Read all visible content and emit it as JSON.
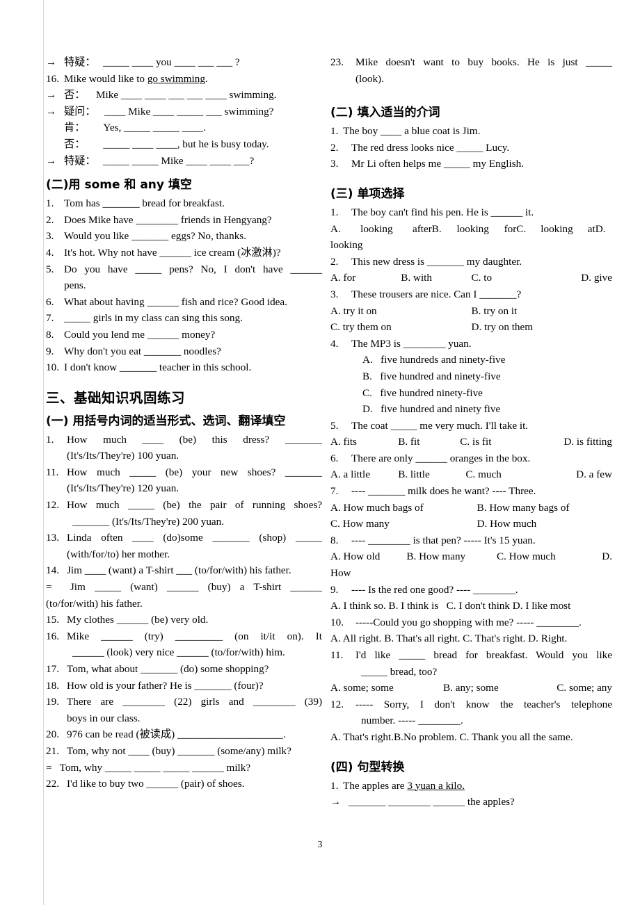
{
  "page": {
    "number": "3"
  },
  "left_column": {
    "top_block": {
      "lines": [
        {
          "arrow": "→",
          "label": "特疑：",
          "text": "_____ ____ you ____ ___ ___ ?"
        },
        {
          "num": "16.",
          "text": "Mike would like to go swimming.",
          "underline": "go swimming"
        },
        {
          "arrow": "→",
          "label": "否：",
          "text": "Mike ____ ____ ___ ___ ____ swimming."
        },
        {
          "arrow": "→",
          "label": "疑问：",
          "text": "____ Mike ____ _____ ___ swimming?"
        },
        {
          "label": "肯：",
          "text": "Yes, _____ _____ ____."
        },
        {
          "label": "否：",
          "text": "_____ ____ ____, but he is busy today."
        },
        {
          "arrow": "→",
          "label": "特疑：",
          "text": "_____ _____ Mike ____ ____ ___?"
        }
      ]
    },
    "section_some_any": {
      "heading": "(二)用 some 和 any  填空",
      "items": [
        {
          "num": "1.",
          "text": "Tom has _______ bread for breakfast."
        },
        {
          "num": "2.",
          "text": "Does Mike have ________ friends in Hengyang?"
        },
        {
          "num": "3.",
          "text": "Would you like _______ eggs? No, thanks."
        },
        {
          "num": "4.",
          "text": "It's hot. Why not have ______ ice cream (冰激淋)?"
        },
        {
          "num": "5.",
          "text": "Do you have _____ pens? No, I don't have ______ pens.",
          "line1": "Do  you  have  _____  pens?  No,  I  don't  have  ______",
          "line2": "pens."
        },
        {
          "num": "6.",
          "text": "What about having ______ fish and rice? Good idea."
        },
        {
          "num": "7.",
          "text": "_____ girls in my class can sing this song."
        },
        {
          "num": "8.",
          "text": "Could you lend me ______ money?"
        },
        {
          "num": "9.",
          "text": "Why don't you eat _______ noodles?"
        },
        {
          "num": "10.",
          "text": "I don't know _______ teacher in this school."
        }
      ]
    },
    "section_three": {
      "heading": "三、基础知识巩固练习",
      "subheading": "(一) 用括号内词的适当形式、选词、翻译填空",
      "items": [
        {
          "num": "1.",
          "line1": "How   much   ____   (be)   this   dress?   _______",
          "line2": "(It's/Its/They're) 100 yuan."
        },
        {
          "num": "11.",
          "line1": "How  much  _____  (be)  your  new  shoes?  _______",
          "line2": "(It's/Its/They're) 120 yuan."
        },
        {
          "num": "12.",
          "line1": "How  much  _____  (be)  the  pair  of  running  shoes?",
          "line2": "_______ (It's/Its/They're) 200 yuan."
        },
        {
          "num": "13.",
          "line1": "Linda  often  ____  (do)some  _______  (shop)  _____",
          "line2": "(with/for/to) her mother."
        },
        {
          "num": "14.",
          "line1": "Jim ____ (want) a T-shirt ___ (to/for/with) his father.",
          "line2": "=    Jim  _____  (want)  ______  (buy)  a  T-shirt  ______",
          "line3": "(to/for/with) his father."
        },
        {
          "num": "15.",
          "line1": "My clothes ______ (be) very old."
        },
        {
          "num": "16.",
          "line1": "Mike  ______  (try)  _________  (on  it/it  on).  It",
          "line2": "______ (look) very nice ______ (to/for/with) him."
        },
        {
          "num": "17.",
          "line1": "Tom, what about _______ (do) some shopping?"
        },
        {
          "num": "18.",
          "line1": "How old is your father? He is _______ (four)?"
        },
        {
          "num": "19.",
          "line1": "There  are  ________  (22)  girls  and  ________  (39)",
          "line2": "boys in our class."
        },
        {
          "num": "20.",
          "line1": "976 can be read (被读成) ____________________."
        },
        {
          "num": "21.",
          "line1": "Tom, why not ____ (buy) _______ (some/any) milk?",
          "line2": "=   Tom, why _____ _____ _____ ______ milk?"
        },
        {
          "num": "22.",
          "line1": "I'd like to buy two ______ (pair) of shoes."
        }
      ]
    }
  },
  "right_column": {
    "item23": {
      "num": "23.",
      "line1": "Mike  doesn't  want  to  buy  books.  He  is  just  _____",
      "line2": "(look)."
    },
    "section_prepositions": {
      "heading": "(二) 填入适当的介词",
      "items": [
        {
          "num": "1.",
          "text": "The boy ____ a blue coat is Jim."
        },
        {
          "num": "2.",
          "text": "The red dress looks nice _____ Lucy."
        },
        {
          "num": "3.",
          "text": "Mr Li often helps me _____ my English."
        }
      ]
    },
    "section_multiple_choice": {
      "heading": "(三) 单项选择",
      "questions": [
        {
          "num": "1.",
          "stem": "The boy can't find his pen. He is ______ it.",
          "options_line1": [
            "A. looking after",
            "B. looking for",
            "C. looking at",
            "D."
          ],
          "options_line2": [
            "looking"
          ],
          "layout": "wrap4"
        },
        {
          "num": "2.",
          "stem": "This new dress is _______ my daughter.",
          "options": [
            "A. for",
            "B. with",
            "C. to",
            "D. give"
          ],
          "layout": "row4"
        },
        {
          "num": "3.",
          "stem": "These trousers are nice. Can I _______?",
          "options_line1": [
            "A. try it on",
            "B. try on it"
          ],
          "options_line2": [
            "C. try them on",
            "D. try on them"
          ],
          "layout": "grid2x2"
        },
        {
          "num": "4.",
          "stem": "The MP3 is ________ yuan.",
          "options_stacked": [
            "A.   five hundreds and ninety-five",
            "B.   five hundred and ninety-five",
            "C.   five hundred ninety-five",
            "D.   five hundred and ninety five"
          ],
          "layout": "stacked"
        },
        {
          "num": "5.",
          "stem": "The coat _____ me very much. I'll take it.",
          "options": [
            "A. fits",
            "B. fit",
            "C. is fit",
            "D. is fitting"
          ],
          "layout": "row4"
        },
        {
          "num": "6.",
          "stem": "There are only ______ oranges in the box.",
          "options": [
            "A. a little",
            "B. little",
            "C. much",
            "D. a few"
          ],
          "layout": "row4"
        },
        {
          "num": "7.",
          "stem": "---- _______ milk does he want? ---- Three.",
          "options_line1": [
            "A. How much bags of",
            "B. How many bags of"
          ],
          "options_line2": [
            "C. How many",
            "D. How much"
          ],
          "layout": "grid2x2"
        },
        {
          "num": "8.",
          "stem": "---- ________ is that pen? ----- It's 15 yuan.",
          "options_line1": [
            "A. How old",
            "B. How many",
            "C. How much",
            "D."
          ],
          "options_line2": [
            "How"
          ],
          "layout": "wrap4"
        },
        {
          "num": "9.",
          "stem": "---- Is the red one good? ---- ________.",
          "options_inline": "A. I think so. B. I think is   C. I don't think D. I like most",
          "layout": "inline"
        },
        {
          "num": "10.",
          "stem": "-----Could you go shopping with me? ----- ________.",
          "options_inline": "A. All right. B. That's all right. C. That's right. D. Right.",
          "layout": "inline"
        },
        {
          "num": "11.",
          "stem_line1": "I'd  like  _____  bread  for  breakfast.  Would  you  like",
          "stem_line2": "_____ bread, too?",
          "options": [
            "A. some; some",
            "B. any; some",
            "C. some; any"
          ],
          "layout": "row3"
        },
        {
          "num": "12.",
          "stem_line1": "-----  Sorry,  I  don't  know  the  teacher's  telephone",
          "stem_line2": "number. ----- ________.",
          "options_inline": "A. That's right.B.No problem. C. Thank you all the same.",
          "layout": "inline"
        }
      ]
    },
    "section_sentence_transform": {
      "heading": "(四) 句型转换",
      "items": [
        {
          "num": "1.",
          "text": "The apples are 3 yuan a kilo.",
          "underline": "3 yuan a kilo."
        },
        {
          "arrow": "→",
          "text": "_______ ________ ______ the apples?"
        }
      ]
    }
  }
}
